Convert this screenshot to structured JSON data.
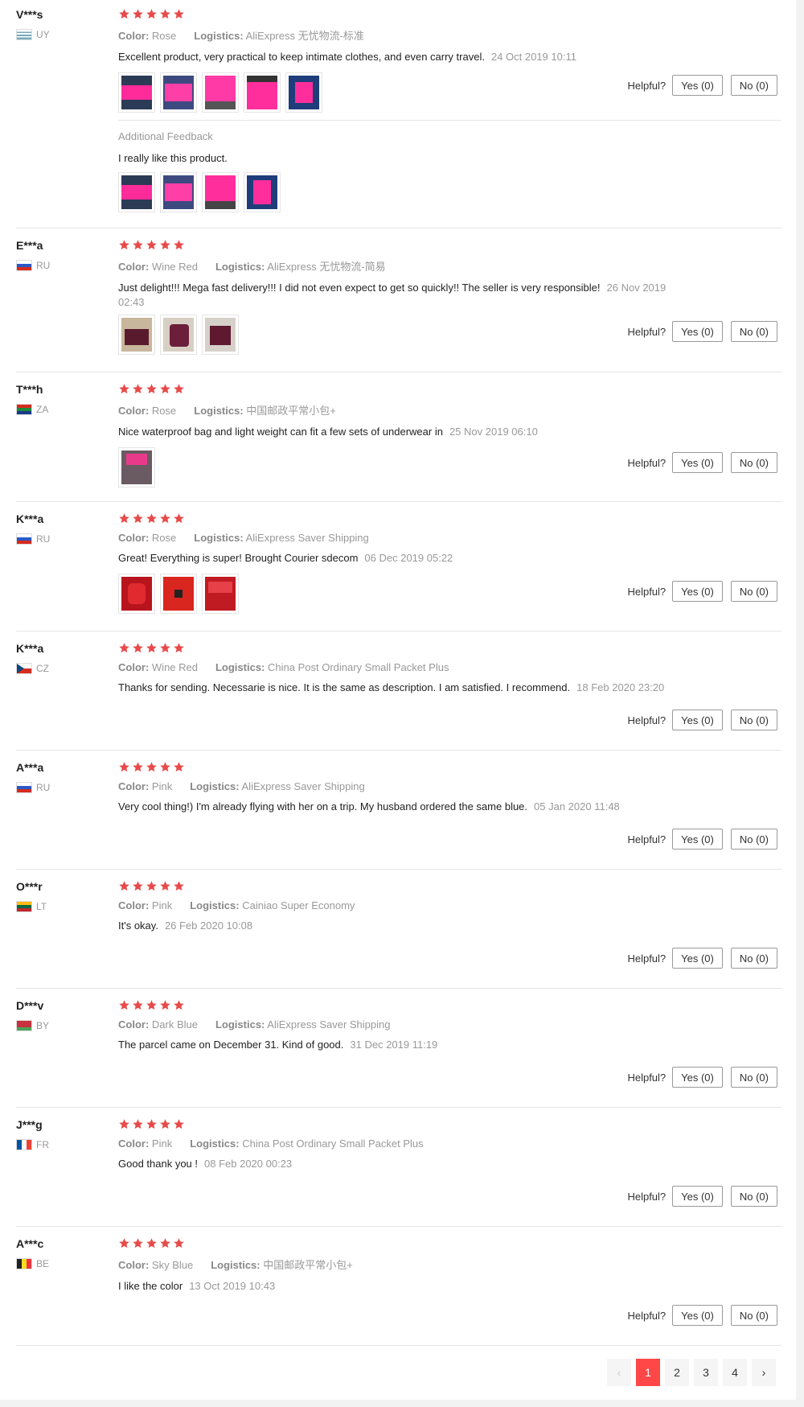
{
  "helpful_label": "Helpful?",
  "yes_label": "Yes (0)",
  "no_label": "No (0)",
  "star_color": "#e84a4a",
  "reviews": [
    {
      "name": "V***s",
      "country": "UY",
      "color_label": "Color:",
      "color": "Rose",
      "logistics_label": "Logistics:",
      "logistics": "AliExpress 无忧物流-标准",
      "text": "Excellent product, very practical to keep intimate clothes, and even carry travel.",
      "date": "24 Oct 2019 10:11",
      "rating": 5
    },
    {
      "name": "E***a",
      "country": "RU",
      "color_label": "Color:",
      "color": "Wine Red",
      "logistics_label": "Logistics:",
      "logistics": "AliExpress 无忧物流-简易",
      "text": "Just delight!!! Mega fast delivery!!! I did not even expect to get so quickly!! The seller is very responsible!",
      "date": "26 Nov 2019 02:43",
      "rating": 5
    },
    {
      "name": "T***h",
      "country": "ZA",
      "color_label": "Color:",
      "color": "Rose",
      "logistics_label": "Logistics:",
      "logistics": "中国邮政平常小包+",
      "text": "Nice waterproof bag and light weight can fit a few sets of underwear in",
      "date": "25 Nov 2019 06:10",
      "rating": 5
    },
    {
      "name": "K***a",
      "country": "RU",
      "color_label": "Color:",
      "color": "Rose",
      "logistics_label": "Logistics:",
      "logistics": "AliExpress Saver Shipping",
      "text": "Great! Everything is super! Brought Courier sdecom",
      "date": "06 Dec 2019 05:22",
      "rating": 5
    },
    {
      "name": "K***a",
      "country": "CZ",
      "color_label": "Color:",
      "color": "Wine Red",
      "logistics_label": "Logistics:",
      "logistics": "China Post Ordinary Small Packet Plus",
      "text": "Thanks for sending. Necessarie is nice. It is the same as description. I am satisfied. I recommend.",
      "date": "18 Feb 2020 23:20",
      "rating": 5
    },
    {
      "name": "A***a",
      "country": "RU",
      "color_label": "Color:",
      "color": "Pink",
      "logistics_label": "Logistics:",
      "logistics": "AliExpress Saver Shipping",
      "text": "Very cool thing!) I'm already flying with her on a trip. My husband ordered the same blue.",
      "date": "05 Jan 2020 11:48",
      "rating": 5
    },
    {
      "name": "O***r",
      "country": "LT",
      "color_label": "Color:",
      "color": "Pink",
      "logistics_label": "Logistics:",
      "logistics": "Cainiao Super Economy",
      "text": "It's okay.",
      "date": "26 Feb 2020 10:08",
      "rating": 5
    },
    {
      "name": "D***v",
      "country": "BY",
      "color_label": "Color:",
      "color": "Dark Blue",
      "logistics_label": "Logistics:",
      "logistics": "AliExpress Saver Shipping",
      "text": "The parcel came on December 31. Kind of good.",
      "date": "31 Dec 2019 11:19",
      "rating": 5
    },
    {
      "name": "J***g",
      "country": "FR",
      "color_label": "Color:",
      "color": "Pink",
      "logistics_label": "Logistics:",
      "logistics": "China Post Ordinary Small Packet Plus",
      "text": "Good thank you !",
      "date": "08 Feb 2020 00:23",
      "rating": 5
    },
    {
      "name": "A***c",
      "country": "BE",
      "color_label": "Color:",
      "color": "Sky Blue",
      "logistics_label": "Logistics:",
      "logistics": "中国邮政平常小包+",
      "text": "I like the color",
      "date": "13 Oct 2019 10:43",
      "rating": 5
    }
  ],
  "additional_feedback": {
    "title": "Additional Feedback",
    "text": "I really like this product."
  },
  "pagination": {
    "prev": "‹",
    "pages": [
      "1",
      "2",
      "3",
      "4"
    ],
    "next": "›",
    "active": "1"
  }
}
